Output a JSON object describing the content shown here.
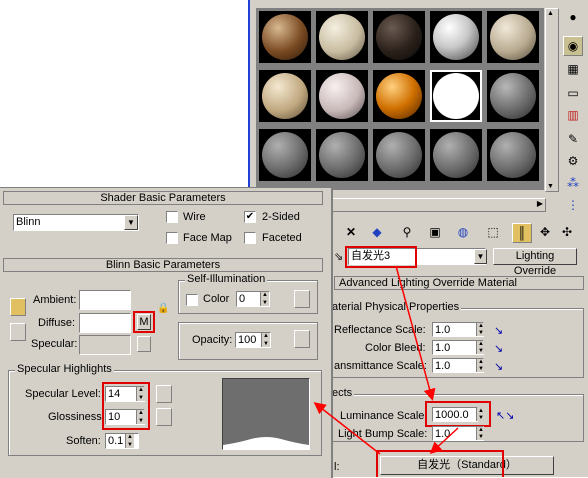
{
  "shader_basic": {
    "title": "Shader Basic Parameters",
    "shader_value": "Blinn",
    "wire": "Wire",
    "two_sided": "2-Sided",
    "face_map": "Face Map",
    "faceted": "Faceted"
  },
  "blinn_basic": {
    "title": "Blinn Basic Parameters",
    "self_illum_title": "Self-Illumination",
    "color_label": "Color",
    "color_value": "0",
    "ambient": "Ambient:",
    "diffuse": "Diffuse:",
    "specular": "Specular:",
    "map_button": "M",
    "opacity_label": "Opacity:",
    "opacity_value": "100"
  },
  "specular_highlights": {
    "title": "Specular Highlights",
    "level_label": "Specular Level:",
    "level_value": "14",
    "gloss_label": "Glossiness:",
    "gloss_value": "10",
    "soften_label": "Soften:",
    "soften_value": "0.1"
  },
  "right_panel": {
    "material_name": "自发光3",
    "lighting_override": "Lighting Override",
    "rollout_title": "Advanced Lighting Override Material",
    "physical_props_title": "aterial Physical Properties",
    "reflectance_label": "Reflectance Scale:",
    "reflectance_value": "1.0",
    "color_bleed_label": "Color Bleed:",
    "color_bleed_value": "1.0",
    "transmittance_label": "ansmittance Scale:",
    "transmittance_value": "1.0",
    "effects_title": "ects",
    "luminance_label": "Luminance Scale:",
    "luminance_value": "1000.0",
    "light_bump_label": "Light Bump Scale:",
    "light_bump_value": "1.0",
    "base_material_label": "l:",
    "base_material_value": "自发光（Standard）"
  },
  "colors": {
    "panel_bg": "#d4d0c8",
    "highlight_red": "#e00000",
    "arrow_red": "#ff0000",
    "blue_frame": "#1f3fd8"
  }
}
